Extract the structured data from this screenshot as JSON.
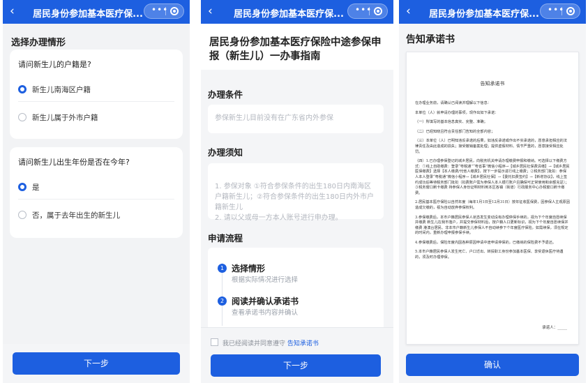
{
  "app": {
    "title": "居民身份参加基本医疗保...",
    "capsule_dots": "•••"
  },
  "screen1": {
    "heading": "选择办理情形",
    "q1": "请问新生儿的户籍是?",
    "q1_options": [
      "新生儿南海区户籍",
      "新生儿属于外市户籍"
    ],
    "q2": "请问新生儿出生年份是否在今年?",
    "q2_options": [
      "是",
      "否，属于去年出生的新生儿"
    ],
    "next": "下一步"
  },
  "screen2": {
    "guide_title": "居民身份参加基本医疗保险中途参保申报（新生儿）一办事指南",
    "conditions_heading": "办理条件",
    "conditions_text": "参保新生儿目前没有在广东省内外参保",
    "notes_heading": "办理须知",
    "notes_text": "1. 参保对象 ①符合参保条件的出生180日内南海区户籍新生儿；②符合参保条件的出生180日内外市户籍新生儿\n2. 请以父或母一方本人账号进行申办理。",
    "process_heading": "申请流程",
    "steps": [
      {
        "num": "1",
        "name": "选择情形",
        "desc": "根据实际情况进行选择"
      },
      {
        "num": "2",
        "name": "阅读并确认承诺书",
        "desc": "查看承诺书内容并确认"
      }
    ],
    "agree_prefix": "我已经阅读并同意遵守",
    "agree_link": "告知承诺书",
    "next": "下一步"
  },
  "screen3": {
    "heading": "告知承诺书",
    "doc_title": "告知承诺书",
    "doc_paragraphs": [
      "在办理业务前，请确认已阅读并理解以下信息：",
      "本单位（人）就申请办理的事项，现作出如下承诺：",
      "（一）所填写的基本信息真实、完整、准确；",
      "（二）已经知晓且符合责任部门告知的全部内容；",
      "（三）本单位（人）已明知违反承诺的后果，如违反承诺或作出不实承诺的，愿意承担相应的法律责任及由此造成的损失；接受撤销备案处理；提供虚假材料、情节严重的，愿意接受相应处罚。",
      "（四）1.已办理参保登记的城乡居民，向税务机关申请办理缴费申报和缴纳。可选择以下缴费方式：①线上自助缴费：登录“粤税通”“粤省事”微信小程序→【城乡居民社保费清缴】→【城乡居民医保缴费】选择【本人缴费/代他人缴费】，按下一步提示进行线上缴费；②税务部门批扣：参保人本人登录“粤税通”微信小程序→【城乡居民社保】→【委托扣费签约】→【新增协议】，线上签约成功后等待税务部门批扣（扣费账户需为参保人本人银行账户且确保可正常使用和余额充足）；③税务窗口刷卡缴费 持参保人身份证明材料到本区各镇（街道）行政服务中心办税窗口刷卡缴费。",
      "2.居民基本医疗保险以自然年度（每年1月1日至12月31日）按年征收医保费，因参保人主观原因造成欠缴的，视为自动放弃参保权利。",
      "3.参保缴费后，本市户籍居民参保人状态发生变动没有办理停保手续的，视为下个年度自愿续保并缴费 新生儿在我市落户，并提交参保材料后，按户籍人口更新标识，视为下个年度自愿续保并缴费 港澳台居民、非本市户籍新生儿参保人不自动续参下个年度医疗保险，如需续保，须在规定的时间内，重新办理申报参保手续。",
      "4.参保缴费后，保险年度内因各种原因申请中途申请停保的，已缴纳的保险费不予退还。",
      "5.本市户籍居民参保人发生死亡、户口迁出、转投职工身份参加基本医保、享受退休医疗待遇的，须及时办理停保。"
    ],
    "sign": "承诺人：_____",
    "confirm": "确认"
  }
}
